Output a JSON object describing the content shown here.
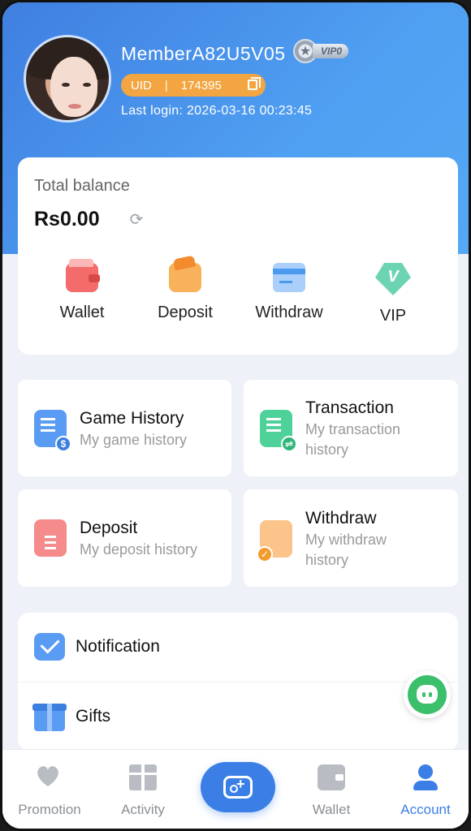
{
  "profile": {
    "username": "MemberA82U5V05",
    "vip_tag": "VIP0",
    "uid_label": "UID",
    "uid_value": "174395",
    "last_login": "Last login: 2026-03-16 00:23:45"
  },
  "balance": {
    "label": "Total balance",
    "value": "Rs0.00"
  },
  "quick_actions": [
    {
      "label": "Wallet",
      "icon": "wallet-icon"
    },
    {
      "label": "Deposit",
      "icon": "deposit-icon"
    },
    {
      "label": "Withdraw",
      "icon": "withdraw-card-icon"
    },
    {
      "label": "VIP",
      "icon": "vip-diamond-icon"
    }
  ],
  "history_tiles": [
    {
      "title": "Game History",
      "subtitle": "My game history",
      "icon": "game-history-icon"
    },
    {
      "title": "Transaction",
      "subtitle": "My transaction history",
      "icon": "transaction-icon"
    },
    {
      "title": "Deposit",
      "subtitle": "My deposit history",
      "icon": "deposit-history-icon"
    },
    {
      "title": "Withdraw",
      "subtitle": "My withdraw history",
      "icon": "withdraw-history-icon"
    }
  ],
  "list": [
    {
      "label": "Notification",
      "icon": "mail-icon"
    },
    {
      "label": "Gifts",
      "icon": "gift-icon"
    }
  ],
  "tabbar": [
    {
      "label": "Promotion",
      "icon": "heart-icon"
    },
    {
      "label": "Activity",
      "icon": "gift-icon"
    },
    {
      "label": "",
      "icon": "gamepad-icon"
    },
    {
      "label": "Wallet",
      "icon": "wallet-icon"
    },
    {
      "label": "Account",
      "icon": "person-icon"
    }
  ],
  "colors": {
    "header_gradient_start": "#3f7fe0",
    "header_gradient_end": "#54a8f4",
    "accent": "#3b7fe6",
    "uid_pill": "#f3a541",
    "chat_green": "#3cbf6b"
  }
}
